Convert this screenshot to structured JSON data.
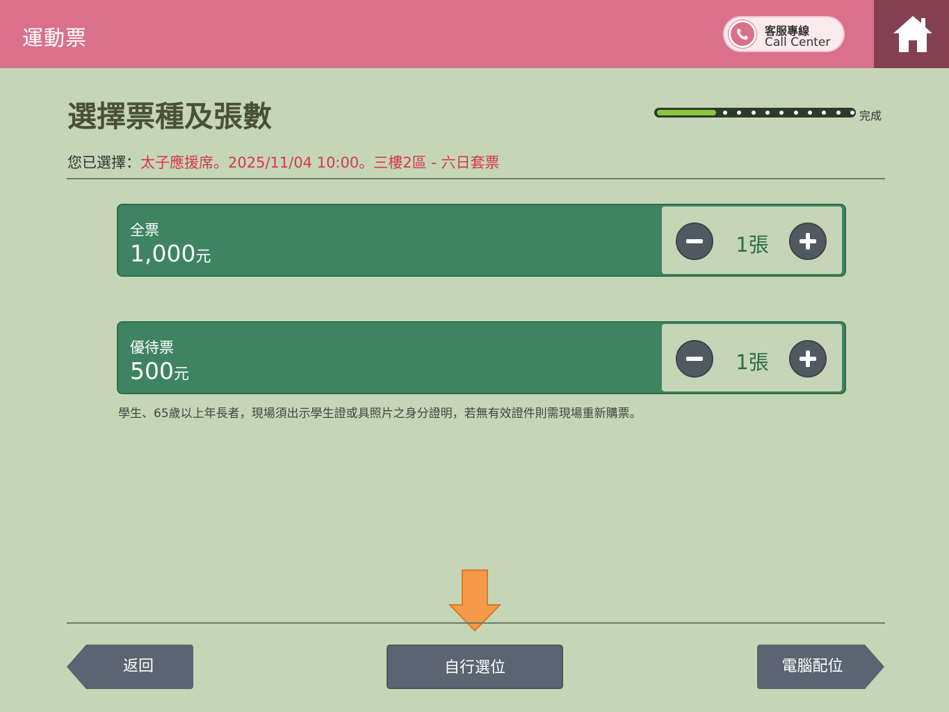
{
  "header": {
    "app_title": "運動票",
    "call_center_zh": "客服專線",
    "call_center_en": "Call Center",
    "home_icon": "home-icon",
    "phone_icon": "phone-icon"
  },
  "page": {
    "title": "選擇票種及張數",
    "progress_label": "完成",
    "progress_fraction": 0.3
  },
  "selection": {
    "prefix": "您已選擇：",
    "value": "太子應援席。2025/11/04 10:00。三樓2區 - 六日套票"
  },
  "tickets": [
    {
      "name": "全票",
      "price": "1,000",
      "unit": "元",
      "quantity": "1張"
    },
    {
      "name": "優待票",
      "price": "500",
      "unit": "元",
      "quantity": "1張"
    }
  ],
  "note": "學生、65歲以上年長者，現場須出示學生證或具照片之身分證明，若無有效證件則需現場重新購票。",
  "buttons": {
    "back": "返回",
    "self_select": "自行選位",
    "auto_select": "電腦配位"
  },
  "colors": {
    "header": "#d9718a",
    "home": "#843f50",
    "ticket": "#3f8460",
    "accent_red": "#d9364a",
    "arrow": "#f59a48"
  }
}
